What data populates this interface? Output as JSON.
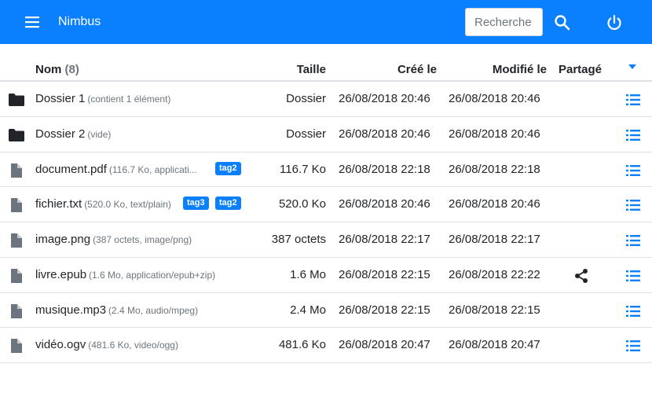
{
  "app": {
    "title": "Nimbus"
  },
  "search": {
    "placeholder": "Recherche"
  },
  "colors": {
    "brand": "#0a80ff",
    "icon_dark": "#212529",
    "file_icon": "#6c757d"
  },
  "table": {
    "headers": {
      "name": "Nom",
      "name_count": "(8)",
      "size": "Taille",
      "created": "Créé le",
      "modified": "Modifié le",
      "shared": "Partagé"
    },
    "rows": [
      {
        "icon": "folder-icon",
        "name": "Dossier 1",
        "meta": "(contient 1 élément)",
        "tags": [],
        "size": "Dossier",
        "created": "26/08/2018 20:46",
        "modified": "26/08/2018 20:46",
        "shared": false
      },
      {
        "icon": "folder-icon",
        "name": "Dossier 2",
        "meta": "(vide)",
        "tags": [],
        "size": "Dossier",
        "created": "26/08/2018 20:46",
        "modified": "26/08/2018 20:46",
        "shared": false
      },
      {
        "icon": "file-icon",
        "name": "document.pdf",
        "meta": "(116.7 Ko, applicati...",
        "tags": [
          "tag2"
        ],
        "size": "116.7 Ko",
        "created": "26/08/2018 22:18",
        "modified": "26/08/2018 22:18",
        "shared": false
      },
      {
        "icon": "file-icon",
        "name": "fichier.txt",
        "meta": "(520.0 Ko, text/plain)",
        "tags": [
          "tag3",
          "tag2"
        ],
        "size": "520.0 Ko",
        "created": "26/08/2018 20:46",
        "modified": "26/08/2018 20:46",
        "shared": false
      },
      {
        "icon": "file-icon",
        "name": "image.png",
        "meta": "(387 octets, image/png)",
        "tags": [],
        "size": "387 octets",
        "created": "26/08/2018 22:17",
        "modified": "26/08/2018 22:17",
        "shared": false
      },
      {
        "icon": "file-icon",
        "name": "livre.epub",
        "meta": "(1.6 Mo, application/epub+zip)",
        "tags": [],
        "size": "1.6 Mo",
        "created": "26/08/2018 22:15",
        "modified": "26/08/2018 22:22",
        "shared": true
      },
      {
        "icon": "file-icon",
        "name": "musique.mp3",
        "meta": "(2.4 Mo, audio/mpeg)",
        "tags": [],
        "size": "2.4 Mo",
        "created": "26/08/2018 22:15",
        "modified": "26/08/2018 22:15",
        "shared": false
      },
      {
        "icon": "file-icon",
        "name": "vidéo.ogv",
        "meta": "(481.6 Ko, video/ogg)",
        "tags": [],
        "size": "481.6 Ko",
        "created": "26/08/2018 20:47",
        "modified": "26/08/2018 20:47",
        "shared": false
      }
    ]
  }
}
